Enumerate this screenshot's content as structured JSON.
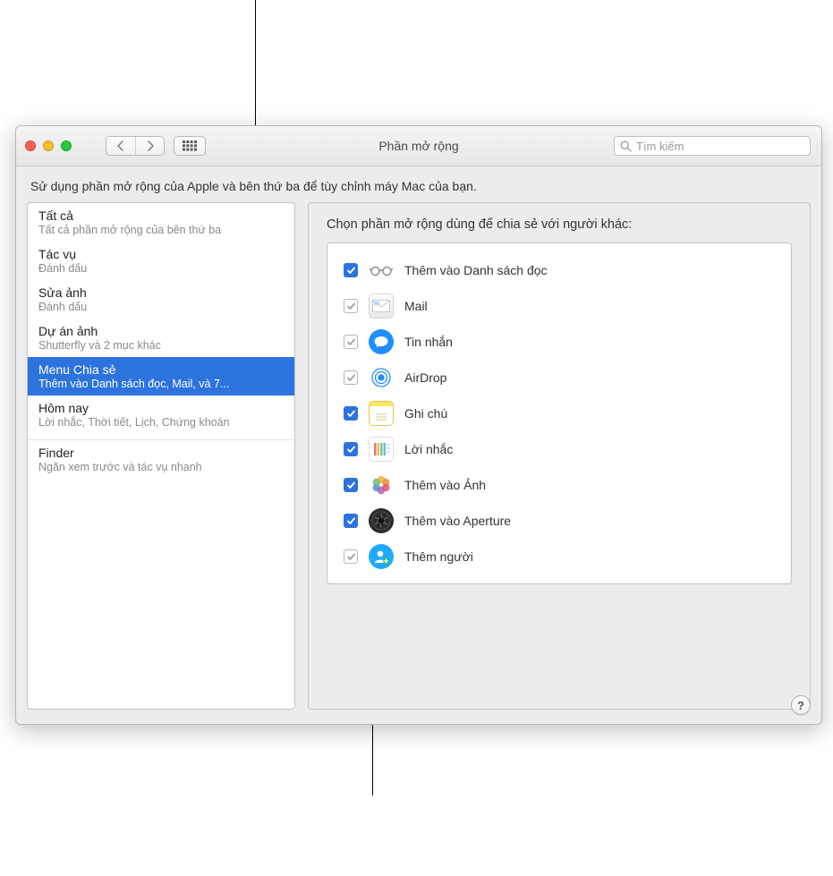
{
  "window": {
    "title": "Phần mở rộng"
  },
  "search": {
    "placeholder": "Tìm kiếm"
  },
  "description": "Sử dụng phần mở rộng của Apple và bên thứ ba để tùy chỉnh máy Mac của bạn.",
  "sidebar": {
    "items": [
      {
        "title": "Tất cả",
        "sub": "Tất cả phần mở rộng của bên thứ ba",
        "selected": false
      },
      {
        "title": "Tác vụ",
        "sub": "Đánh dấu",
        "selected": false
      },
      {
        "title": "Sửa ảnh",
        "sub": "Đánh dấu",
        "selected": false
      },
      {
        "title": "Dự án ảnh",
        "sub": "Shutterfly và 2 mục khác",
        "selected": false
      },
      {
        "title": "Menu Chia sẻ",
        "sub": "Thêm vào Danh sách đọc, Mail, và 7...",
        "selected": true
      },
      {
        "title": "Hôm nay",
        "sub": "Lời nhắc, Thời tiết, Lịch, Chứng khoán",
        "selected": false
      }
    ],
    "finder": {
      "title": "Finder",
      "sub": "Ngăn xem trước và tác vụ nhanh"
    }
  },
  "main": {
    "heading": "Chọn phần mở rộng dùng để chia sẻ với người khác:",
    "extensions": [
      {
        "label": "Thêm vào Danh sách đọc",
        "checked": true,
        "locked": false,
        "icon": "glasses"
      },
      {
        "label": "Mail",
        "checked": true,
        "locked": true,
        "icon": "mail"
      },
      {
        "label": "Tin nhắn",
        "checked": true,
        "locked": true,
        "icon": "messages"
      },
      {
        "label": "AirDrop",
        "checked": true,
        "locked": true,
        "icon": "airdrop"
      },
      {
        "label": "Ghi chú",
        "checked": true,
        "locked": false,
        "icon": "notes"
      },
      {
        "label": "Lời nhắc",
        "checked": true,
        "locked": false,
        "icon": "reminders"
      },
      {
        "label": "Thêm vào Ảnh",
        "checked": true,
        "locked": false,
        "icon": "photos"
      },
      {
        "label": "Thêm vào Aperture",
        "checked": true,
        "locked": false,
        "icon": "aperture"
      },
      {
        "label": "Thêm người",
        "checked": true,
        "locked": true,
        "icon": "people"
      }
    ]
  },
  "help_label": "?"
}
